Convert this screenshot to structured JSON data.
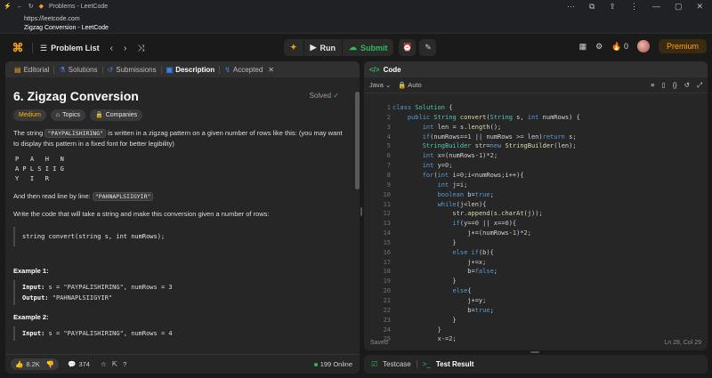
{
  "browser": {
    "tab_title": "Problems - LeetCode",
    "url": "https://leetcode.com",
    "page_title": "Zigzag Conversion - LeetCode"
  },
  "nav": {
    "problem_list": "Problem List",
    "run": "Run",
    "submit": "Submit",
    "streak": "0",
    "premium": "Premium"
  },
  "left_tabs": [
    "Editorial",
    "Solutions",
    "Submissions",
    "Description",
    "Accepted"
  ],
  "problem": {
    "title": "6. Zigzag Conversion",
    "status": "Solved",
    "difficulty": "Medium",
    "topics": "Topics",
    "companies": "Companies",
    "p1_a": "The string ",
    "p1_code": "\"PAYPALISHIRING\"",
    "p1_b": " is written in a zigzag pattern on a given number of rows like this: (you may want to display this pattern in a fixed font for better legibility)",
    "pattern": "P   A   H   N\nA P L S I I G\nY   I   R",
    "p2_a": "And then read line by line: ",
    "p2_code": "\"PAHNAPLSIIGYIR\"",
    "p3": "Write the code that will take a string and make this conversion given a number of rows:",
    "signature": "string convert(string s, int numRows);",
    "ex1_title": "Example 1:",
    "ex1_input_label": "Input:",
    "ex1_input": " s = \"PAYPALISHIRING\", numRows = 3",
    "ex1_output_label": "Output:",
    "ex1_output": " \"PAHNAPLSIIGYIR\"",
    "ex2_title": "Example 2:",
    "ex2_input_label": "Input:",
    "ex2_input": " s = \"PAYPALISHIRING\", numRows = 4"
  },
  "footer": {
    "likes": "8.2K",
    "comments": "374",
    "online": "199 Online"
  },
  "code": {
    "tab": "Code",
    "language": "Java",
    "mode": "Auto",
    "saved": "Saved",
    "cursor": "Ln 28, Col 29",
    "line_numbers": [
      "1",
      "2",
      "3",
      "4",
      "5",
      "6",
      "7",
      "8",
      "9",
      "10",
      "11",
      "12",
      "13",
      "14",
      "15",
      "16",
      "17",
      "18",
      "19",
      "20",
      "21",
      "22",
      "23",
      "24",
      "25"
    ]
  },
  "test": {
    "testcase": "Testcase",
    "result": "Test Result"
  }
}
